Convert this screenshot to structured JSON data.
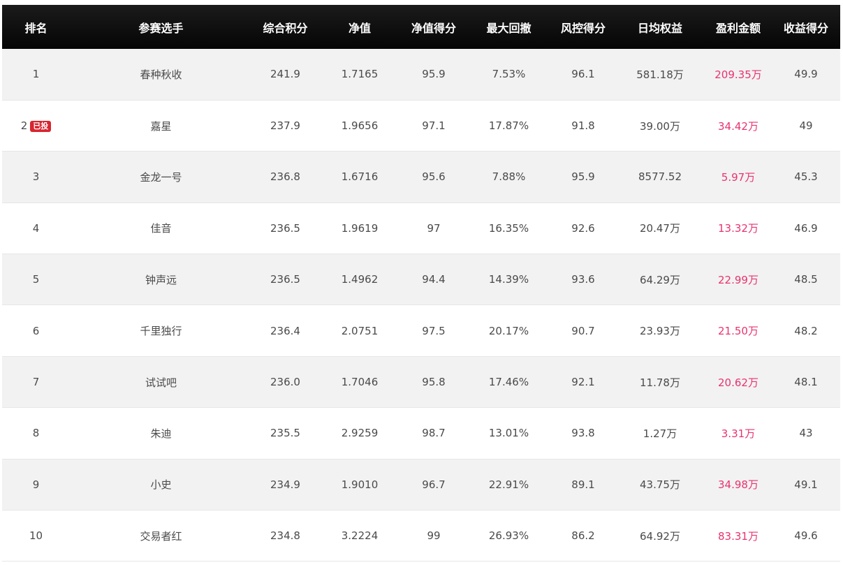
{
  "table": {
    "headers": [
      "排名",
      "参赛选手",
      "综合积分",
      "净值",
      "净值得分",
      "最大回撤",
      "风控得分",
      "日均权益",
      "盈利金额",
      "收益得分"
    ],
    "rows": [
      {
        "rank": "1",
        "badge": "",
        "player": "春种秋收",
        "score": "241.9",
        "nav": "1.7165",
        "nav_score": "95.9",
        "max_drawdown": "7.53%",
        "risk_score": "96.1",
        "avg_equity": "581.18万",
        "profit": "209.35万",
        "return_score": "49.9"
      },
      {
        "rank": "2",
        "badge": "已投",
        "player": "嘉星",
        "score": "237.9",
        "nav": "1.9656",
        "nav_score": "97.1",
        "max_drawdown": "17.87%",
        "risk_score": "91.8",
        "avg_equity": "39.00万",
        "profit": "34.42万",
        "return_score": "49"
      },
      {
        "rank": "3",
        "badge": "",
        "player": "金龙一号",
        "score": "236.8",
        "nav": "1.6716",
        "nav_score": "95.6",
        "max_drawdown": "7.88%",
        "risk_score": "95.9",
        "avg_equity": "8577.52",
        "profit": "5.97万",
        "return_score": "45.3"
      },
      {
        "rank": "4",
        "badge": "",
        "player": "佳音",
        "score": "236.5",
        "nav": "1.9619",
        "nav_score": "97",
        "max_drawdown": "16.35%",
        "risk_score": "92.6",
        "avg_equity": "20.47万",
        "profit": "13.32万",
        "return_score": "46.9"
      },
      {
        "rank": "5",
        "badge": "",
        "player": "钟声远",
        "score": "236.5",
        "nav": "1.4962",
        "nav_score": "94.4",
        "max_drawdown": "14.39%",
        "risk_score": "93.6",
        "avg_equity": "64.29万",
        "profit": "22.99万",
        "return_score": "48.5"
      },
      {
        "rank": "6",
        "badge": "",
        "player": "千里独行",
        "score": "236.4",
        "nav": "2.0751",
        "nav_score": "97.5",
        "max_drawdown": "20.17%",
        "risk_score": "90.7",
        "avg_equity": "23.93万",
        "profit": "21.50万",
        "return_score": "48.2"
      },
      {
        "rank": "7",
        "badge": "",
        "player": "试试吧",
        "score": "236.0",
        "nav": "1.7046",
        "nav_score": "95.8",
        "max_drawdown": "17.46%",
        "risk_score": "92.1",
        "avg_equity": "11.78万",
        "profit": "20.62万",
        "return_score": "48.1"
      },
      {
        "rank": "8",
        "badge": "",
        "player": "朱迪",
        "score": "235.5",
        "nav": "2.9259",
        "nav_score": "98.7",
        "max_drawdown": "13.01%",
        "risk_score": "93.8",
        "avg_equity": "1.27万",
        "profit": "3.31万",
        "return_score": "43"
      },
      {
        "rank": "9",
        "badge": "",
        "player": "小史",
        "score": "234.9",
        "nav": "1.9010",
        "nav_score": "96.7",
        "max_drawdown": "22.91%",
        "risk_score": "89.1",
        "avg_equity": "43.75万",
        "profit": "34.98万",
        "return_score": "49.1"
      },
      {
        "rank": "10",
        "badge": "",
        "player": "交易者红",
        "score": "234.8",
        "nav": "3.2224",
        "nav_score": "99",
        "max_drawdown": "26.93%",
        "risk_score": "86.2",
        "avg_equity": "64.92万",
        "profit": "83.31万",
        "return_score": "49.6"
      }
    ]
  },
  "colors": {
    "header_bg": "#0a0a0a",
    "header_text": "#ffffff",
    "row_alt_bg": "#f2f2f2",
    "row_bg": "#ffffff",
    "text": "#4a4a4a",
    "profit_text": "#e8336d",
    "badge_bg": "#d8262f"
  }
}
